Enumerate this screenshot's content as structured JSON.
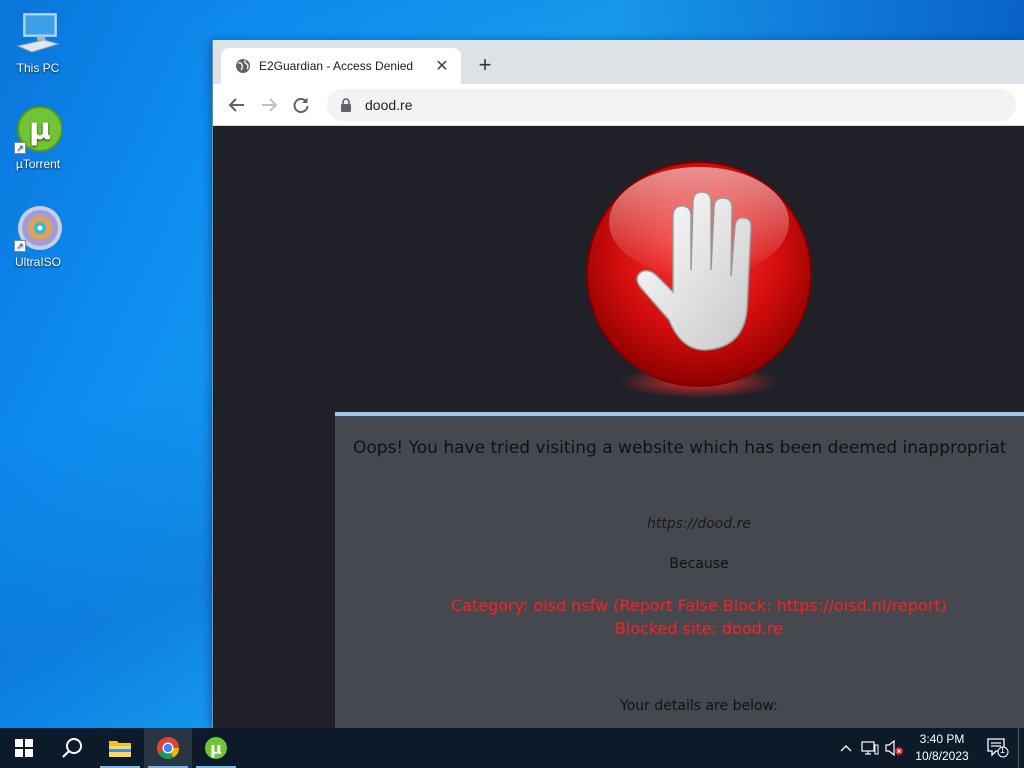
{
  "desktop": {
    "icons": [
      {
        "label": "This PC",
        "icon": "computer-icon"
      },
      {
        "label": "µTorrent",
        "icon": "utorrent-icon"
      },
      {
        "label": "UltraISO",
        "icon": "disc-icon"
      }
    ]
  },
  "browser": {
    "tab": {
      "title": "E2Guardian - Access Denied",
      "close": "✕"
    },
    "new_tab": "+",
    "address": "dood.re"
  },
  "page": {
    "heading": "Oops! You have tried visiting a website which has been deemed inappropriat",
    "url": "https://dood.re",
    "because": "Because",
    "reason_line1": "Category: oisd nsfw (Report False Block: https://oisd.nl/report)",
    "reason_line2": "Blocked site: dood.re",
    "details": "Your details are below:"
  },
  "taskbar": {
    "time": "3:40 PM",
    "date": "10/8/2023",
    "notification_count": "1",
    "pinned": [
      "start-icon",
      "search-icon",
      "file-explorer-icon",
      "chrome-icon",
      "utorrent-icon"
    ]
  },
  "colors": {
    "block_red": "#ff1f1f",
    "panel_bg": "#46484f",
    "page_bg": "#202128"
  }
}
